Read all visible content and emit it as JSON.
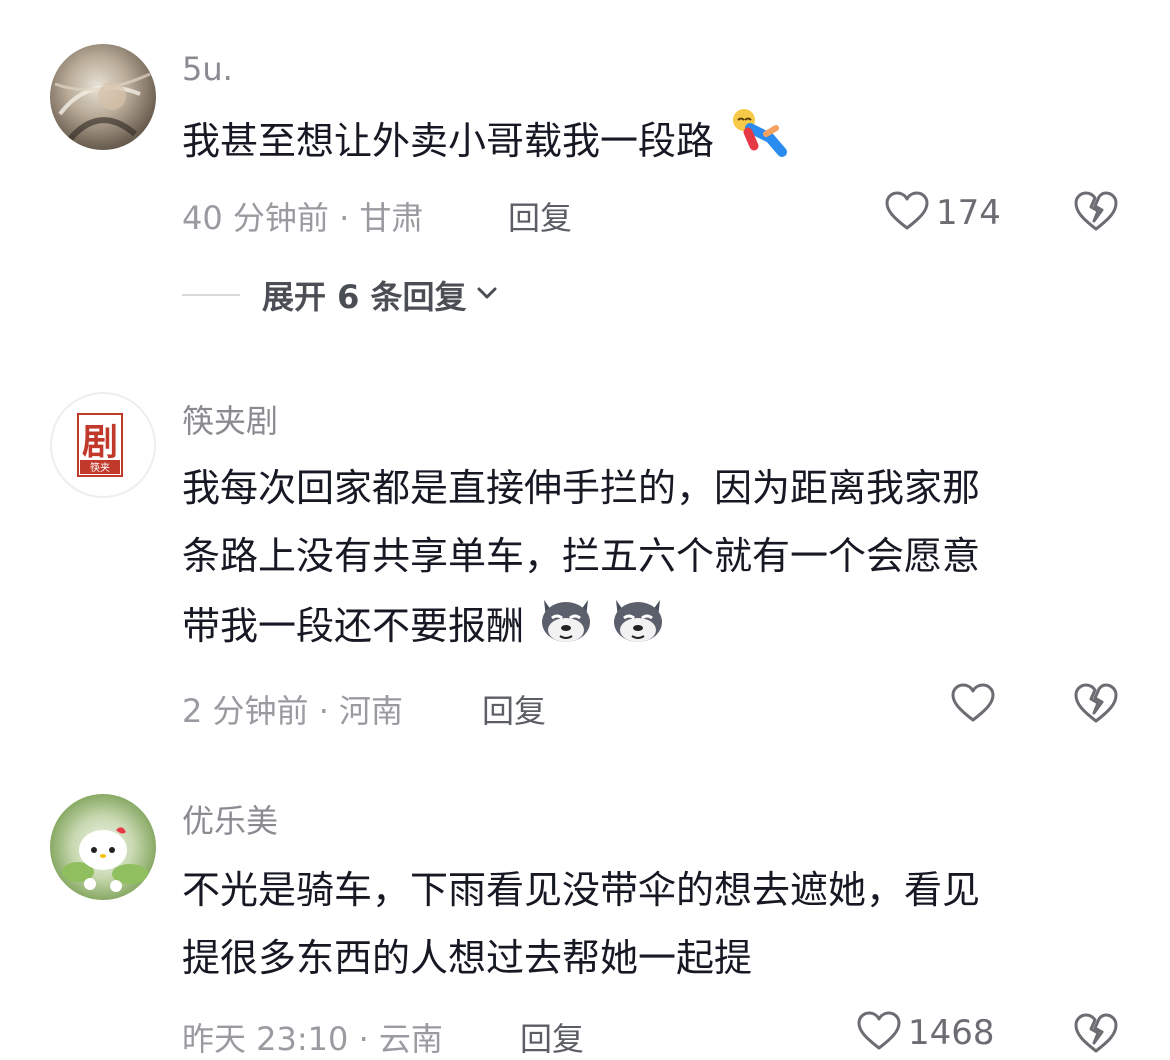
{
  "comments": [
    {
      "username": "5u.",
      "text": "我甚至想让外卖小哥载我一段路",
      "time_location": "40 分钟前 · 甘肃",
      "reply_label": "回复",
      "likes": "174",
      "expand_label": "展开 6 条回复",
      "emoji": "lying-person-emoji"
    },
    {
      "username": "筷夹剧",
      "avatar_text": "剧",
      "avatar_badge": "筷夹",
      "text_lines": [
        "我每次回家都是直接伸手拦的，因为距离我家那",
        "条路上没有共享单车，拦五六个就有一个会愿意",
        "带我一段还不要报酬"
      ],
      "time_location": "2 分钟前 · 河南",
      "reply_label": "回复",
      "likes": "",
      "emoji": "husky-dog-emoji"
    },
    {
      "username": "优乐美",
      "text_lines": [
        "不光是骑车，下雨看见没带伞的想去遮她，看见",
        "提很多东西的人想过去帮她一起提"
      ],
      "time_location": "昨天 23:10 · 云南",
      "reply_label": "回复",
      "likes": "1468"
    }
  ],
  "colors": {
    "text_primary": "#161823",
    "text_secondary": "#8a8b91",
    "icon_gray": "#6b6d73"
  }
}
